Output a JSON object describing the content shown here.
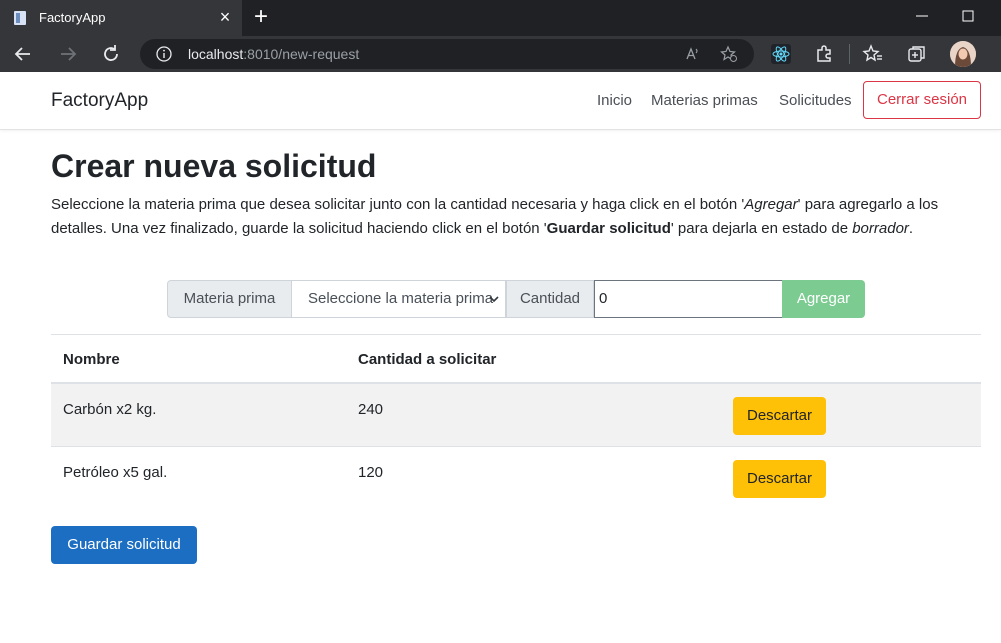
{
  "browser": {
    "tab_title": "FactoryApp",
    "url_host": "localhost",
    "url_rest": ":8010/new-request"
  },
  "navbar": {
    "brand": "FactoryApp",
    "links": [
      "Inicio",
      "Materias primas",
      "Solicitudes"
    ],
    "logout_label": "Cerrar sesión"
  },
  "main": {
    "title": "Crear nueva solicitud",
    "intro": {
      "part1": "Seleccione la materia prima que desea solicitar junto con la cantidad necesaria y haga click en el botón '",
      "agregar_em": "Agregar",
      "part2": "' para agregarlo a los detalles. Una vez finalizado, guarde la solicitud haciendo click en el botón '",
      "guardar_strong": "Guardar solicitud",
      "part3": "' para dejarla en estado de ",
      "borrador_em": "borrador",
      "part4": "."
    },
    "form": {
      "materia_label": "Materia prima",
      "materia_selected": "Seleccione la materia prima",
      "cantidad_label": "Cantidad",
      "cantidad_value": "0",
      "add_label": "Agregar"
    },
    "table": {
      "headers": [
        "Nombre",
        "Cantidad a solicitar"
      ],
      "rows": [
        {
          "nombre": "Carbón x2 kg.",
          "cantidad": "240",
          "action": "Descartar"
        },
        {
          "nombre": "Petróleo x5 gal.",
          "cantidad": "120",
          "action": "Descartar"
        }
      ]
    },
    "save_label": "Guardar solicitud"
  },
  "colors": {
    "primary": "#1b6ec2",
    "danger": "#dc3545",
    "warning": "#ffc107",
    "success_disabled": "#7ccb91"
  }
}
